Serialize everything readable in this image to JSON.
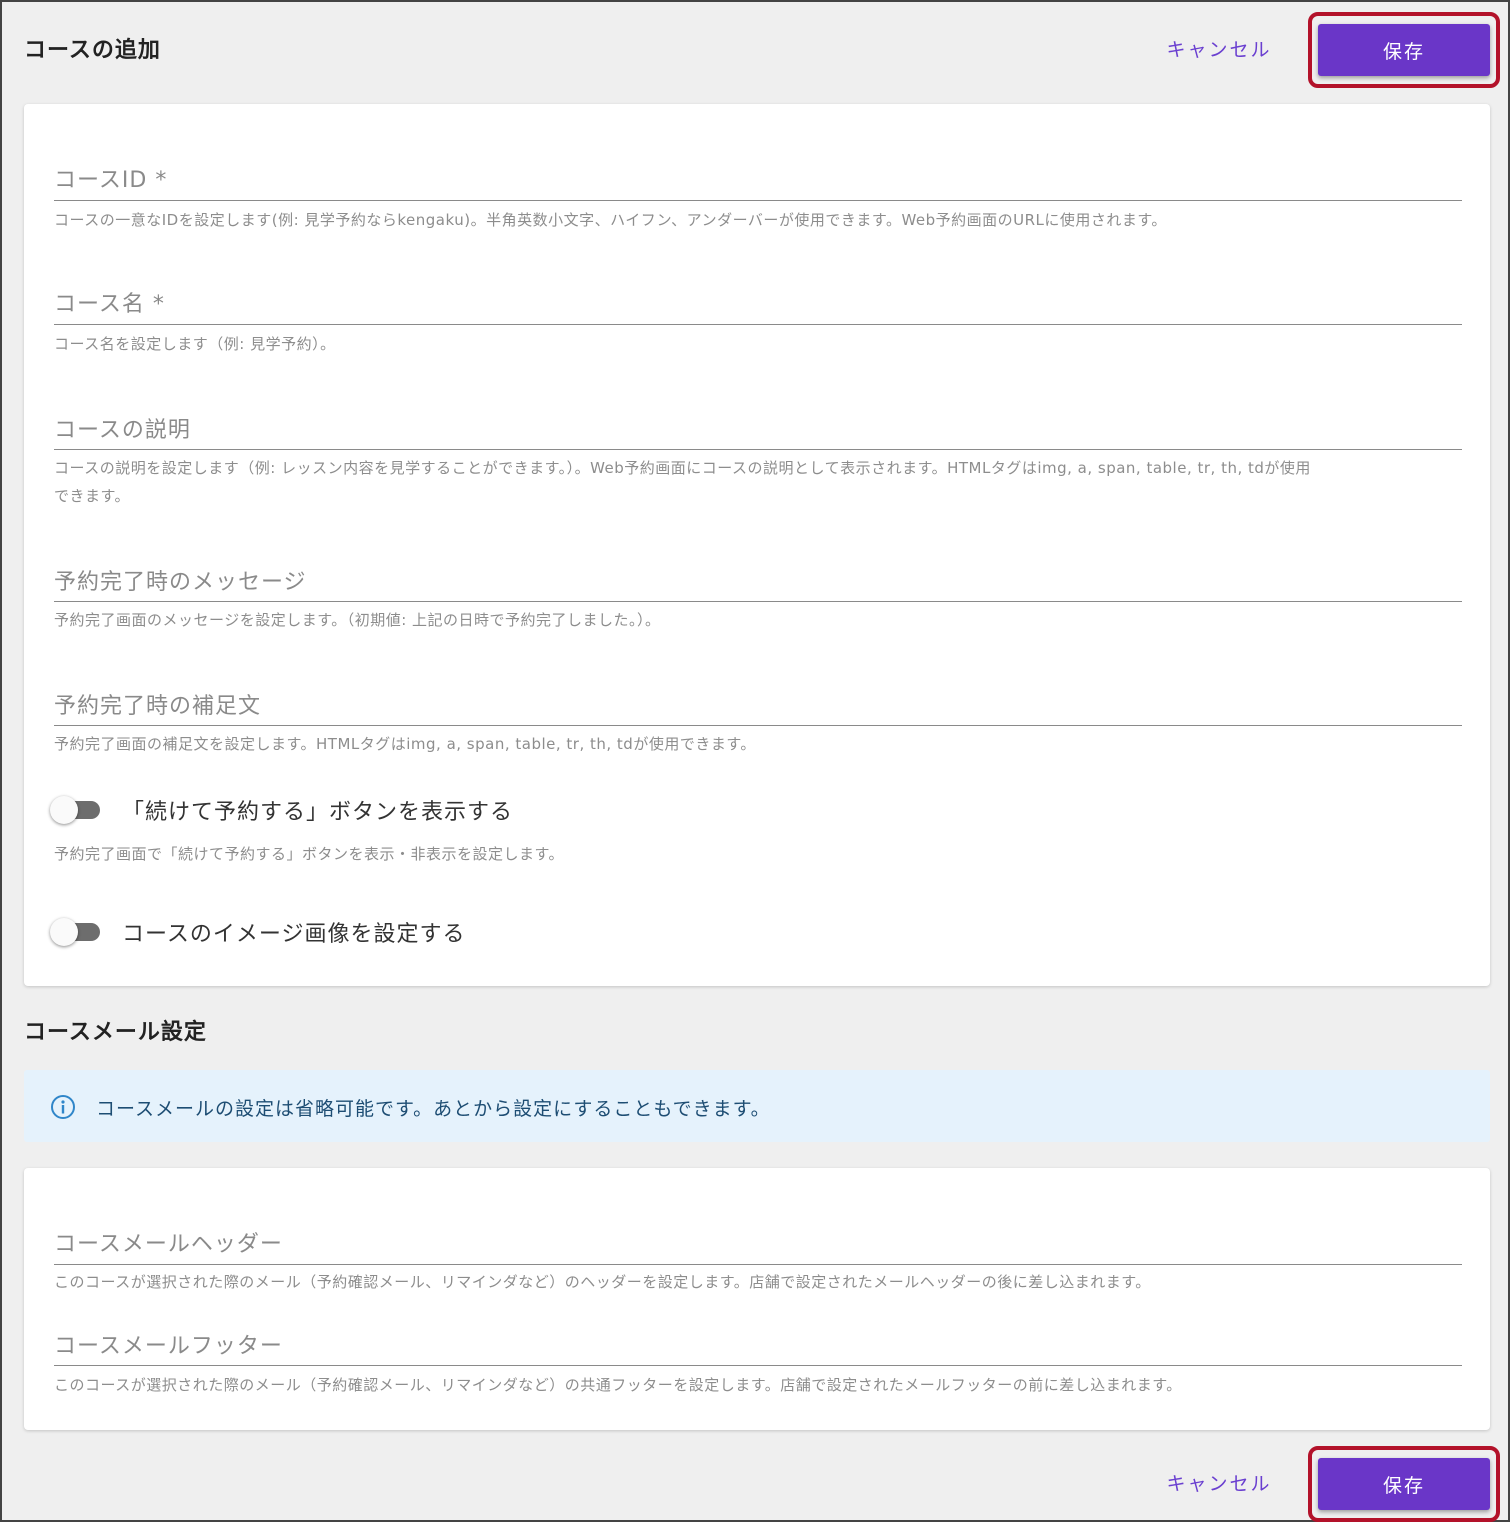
{
  "header": {
    "title": "コースの追加",
    "cancel_label": "キャンセル",
    "save_label": "保存"
  },
  "course_form": {
    "course_id": {
      "label": "コースID *",
      "hint": "コースの一意なIDを設定します(例: 見学予約ならkengaku)。半角英数小文字、ハイフン、アンダーバーが使用できます。Web予約画面のURLに使用されます。"
    },
    "course_name": {
      "label": "コース名 *",
      "hint": "コース名を設定します（例: 見学予約）。"
    },
    "course_description": {
      "label": "コースの説明",
      "hint_line1": "コースの説明を設定します（例: レッスン内容を見学することができます。）。Web予約画面にコースの説明として表示されます。HTMLタグはimg, a, span, table, tr, th, tdが使用",
      "hint_line2": "できます。"
    },
    "completion_message": {
      "label": "予約完了時のメッセージ",
      "hint": "予約完了画面のメッセージを設定します。（初期値: 上記の日時で予約完了しました。）。"
    },
    "completion_note": {
      "label": "予約完了時の補足文",
      "hint": "予約完了画面の補足文を設定します。HTMLタグはimg, a, span, table, tr, th, tdが使用できます。"
    },
    "continue_toggle": {
      "label": "「続けて予約する」ボタンを表示する",
      "hint": "予約完了画面で「続けて予約する」ボタンを表示・非表示を設定します。",
      "checked": false
    },
    "image_toggle": {
      "label": "コースのイメージ画像を設定する",
      "checked": false
    }
  },
  "mail_section": {
    "title": "コースメール設定",
    "info_icon": "info-circle-icon",
    "info_text": "コースメールの設定は省略可能です。あとから設定にすることもできます。",
    "mail_header": {
      "label": "コースメールヘッダー",
      "hint": "このコースが選択された際のメール（予約確認メール、リマインダなど）のヘッダーを設定します。店舗で設定されたメールヘッダーの後に差し込まれます。"
    },
    "mail_footer": {
      "label": "コースメールフッター",
      "hint": "このコースが選択された際のメール（予約確認メール、リマインダなど）の共通フッターを設定します。店舗で設定されたメールフッターの前に差し込まれます。"
    }
  },
  "footer": {
    "cancel_label": "キャンセル",
    "save_label": "保存"
  },
  "colors": {
    "accent": "#6a36c8",
    "highlight_border": "#b3122a",
    "info_background": "#e5f2fc"
  }
}
